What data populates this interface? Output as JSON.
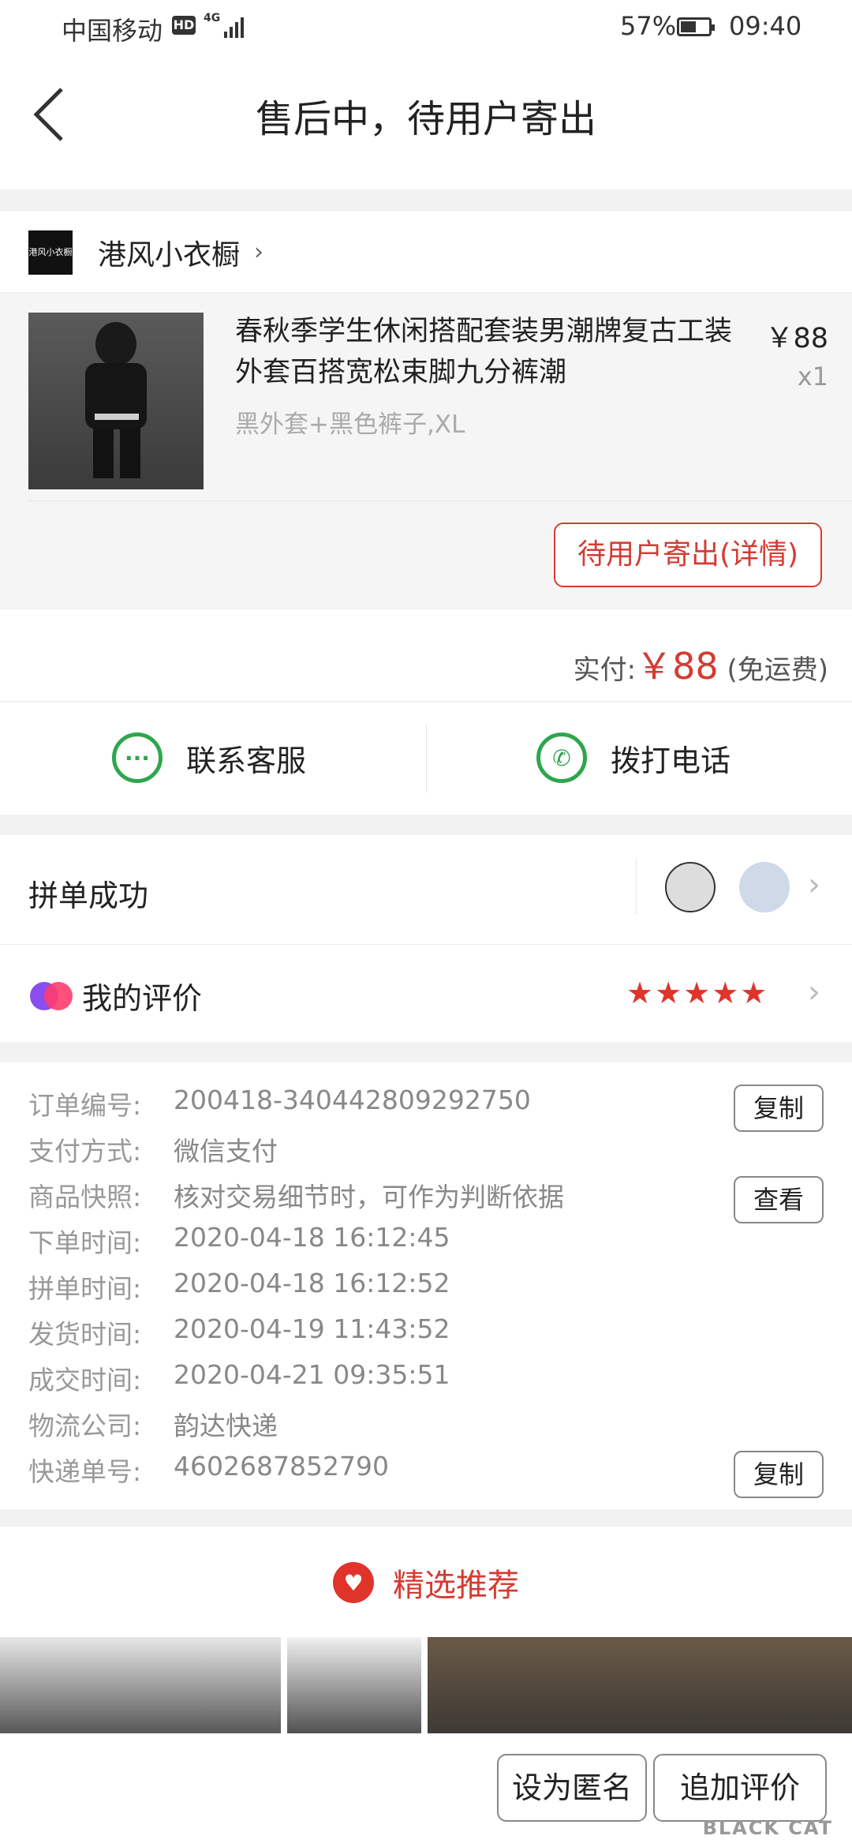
{
  "status_bar": {
    "carrier": "中国移动",
    "hd": "HD",
    "network": "4G",
    "battery": "57%",
    "battery_level": 0.57,
    "time": "09:40"
  },
  "header": {
    "title": "售后中，待用户寄出"
  },
  "store": {
    "logo_text": "港风小衣橱",
    "name": "港风小衣橱"
  },
  "goods": {
    "title": "春秋季学生休闲搭配套装男潮牌复古工装外套百搭宽松束脚九分裤潮",
    "price": "￥88",
    "qty": "x1",
    "spec": "黑外套+黑色裤子,XL",
    "status_button": "待用户寄出(详情)"
  },
  "payment": {
    "label": "实付:",
    "amount": "￥88",
    "note": "(免运费)"
  },
  "contact": {
    "service_label": "联系客服",
    "call_label": "拨打电话"
  },
  "group": {
    "title": "拼单成功",
    "eval_title": "我的评价",
    "stars": "★★★★★",
    "rating": 5
  },
  "order_info": {
    "rows": [
      {
        "k": "订单编号:",
        "v": "200418-340442809292750"
      },
      {
        "k": "支付方式:",
        "v": "微信支付"
      },
      {
        "k": "商品快照:",
        "v": "核对交易细节时，可作为判断依据"
      },
      {
        "k": "下单时间:",
        "v": "2020-04-18 16:12:45"
      },
      {
        "k": "拼单时间:",
        "v": "2020-04-18 16:12:52"
      },
      {
        "k": "发货时间:",
        "v": "2020-04-19 11:43:52"
      },
      {
        "k": "成交时间:",
        "v": "2020-04-21 09:35:51"
      },
      {
        "k": "物流公司:",
        "v": "韵达快递"
      },
      {
        "k": "快递单号:",
        "v": "4602687852790"
      }
    ],
    "copy_label": "复制",
    "view_label": "查看"
  },
  "recommend": {
    "title": "精选推荐"
  },
  "bottom": {
    "anonymous_label": "设为匿名",
    "add_review_label": "追加评价"
  },
  "watermark": "BLACK CAT",
  "colors": {
    "accent": "#d43b33",
    "green": "#2ea64c"
  }
}
